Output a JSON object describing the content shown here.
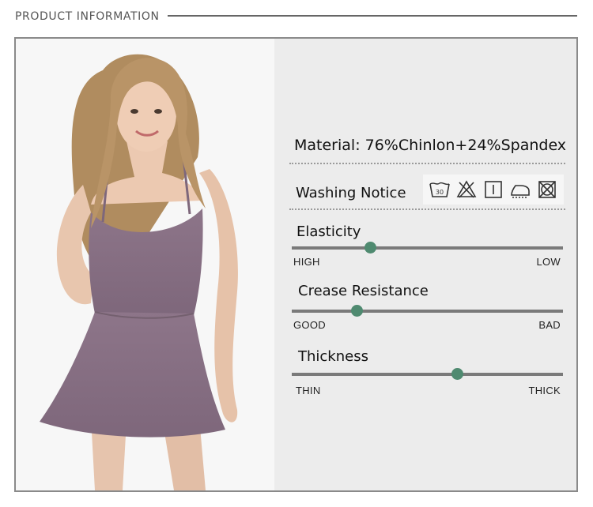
{
  "header": {
    "title": "PRODUCT INFORMATION"
  },
  "product": {
    "material": "Material: 76%Chinlon+24%Spandex",
    "washing_label": "Washing Notice",
    "care_icons": [
      "wash-30-icon",
      "do-not-bleach-icon",
      "tumble-dry-icon",
      "iron-low-icon",
      "do-not-tumble-dry-icon"
    ],
    "care_wash_temp": "30"
  },
  "attributes": [
    {
      "name": "Elasticity",
      "left_label": "HIGH",
      "right_label": "LOW",
      "level": 0.29
    },
    {
      "name": "Crease Resistance",
      "left_label": "GOOD",
      "right_label": "BAD",
      "level": 0.24
    },
    {
      "name": "Thickness",
      "left_label": "THIN",
      "right_label": "THICK",
      "level": 0.61
    }
  ],
  "colors": {
    "accent": "#4f8a70",
    "dress": "#8a7286",
    "panel": "#ececec"
  }
}
